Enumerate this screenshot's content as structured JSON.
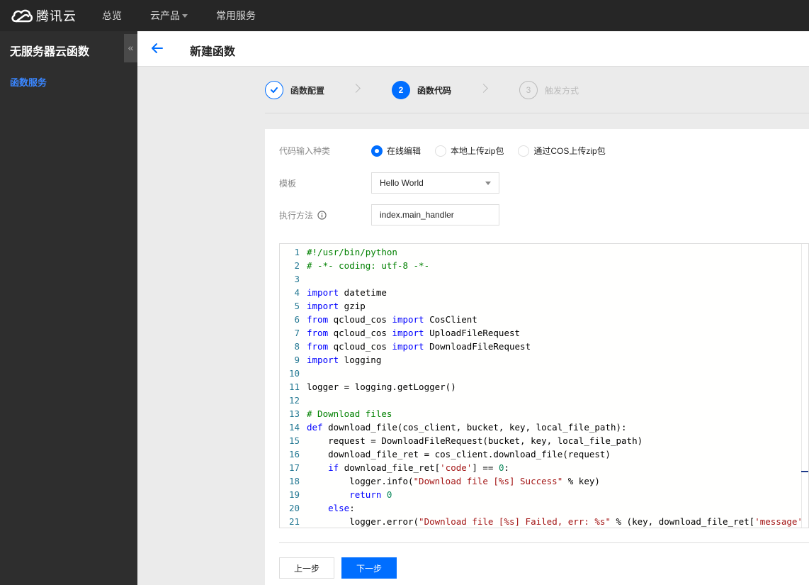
{
  "topbar": {
    "logo_text": "腾讯云",
    "nav": [
      {
        "label": "总览",
        "dropdown": false
      },
      {
        "label": "云产品",
        "dropdown": true
      },
      {
        "label": "常用服务",
        "dropdown": false
      }
    ]
  },
  "sidebar": {
    "title": "无服务器云函数",
    "collapse_icon": "«",
    "items": [
      {
        "label": "函数服务",
        "active": true
      }
    ]
  },
  "header": {
    "title": "新建函数",
    "back_icon": "arrow-left-icon"
  },
  "steps": [
    {
      "number": "1",
      "label": "函数配置",
      "status": "done"
    },
    {
      "number": "2",
      "label": "函数代码",
      "status": "current"
    },
    {
      "number": "3",
      "label": "触发方式",
      "status": "pending"
    }
  ],
  "form": {
    "code_input_type": {
      "label": "代码输入种类",
      "options": [
        {
          "label": "在线编辑",
          "checked": true
        },
        {
          "label": "本地上传zip包",
          "checked": false
        },
        {
          "label": "通过COS上传zip包",
          "checked": false
        }
      ]
    },
    "template": {
      "label": "模板",
      "value": "Hello World"
    },
    "handler": {
      "label": "执行方法",
      "value": "index.main_handler"
    }
  },
  "editor": {
    "lines": [
      {
        "n": "1",
        "tokens": [
          [
            "cm",
            "#!/usr/bin/python"
          ]
        ]
      },
      {
        "n": "2",
        "tokens": [
          [
            "cm",
            "# -*- coding: utf-8 -*-"
          ]
        ]
      },
      {
        "n": "3",
        "tokens": []
      },
      {
        "n": "4",
        "tokens": [
          [
            "kw",
            "import"
          ],
          [
            "code",
            " datetime"
          ]
        ]
      },
      {
        "n": "5",
        "tokens": [
          [
            "kw",
            "import"
          ],
          [
            "code",
            " gzip"
          ]
        ]
      },
      {
        "n": "6",
        "tokens": [
          [
            "kw",
            "from"
          ],
          [
            "code",
            " qcloud_cos "
          ],
          [
            "kw",
            "import"
          ],
          [
            "code",
            " CosClient"
          ]
        ]
      },
      {
        "n": "7",
        "tokens": [
          [
            "kw",
            "from"
          ],
          [
            "code",
            " qcloud_cos "
          ],
          [
            "kw",
            "import"
          ],
          [
            "code",
            " UploadFileRequest"
          ]
        ]
      },
      {
        "n": "8",
        "tokens": [
          [
            "kw",
            "from"
          ],
          [
            "code",
            " qcloud_cos "
          ],
          [
            "kw",
            "import"
          ],
          [
            "code",
            " DownloadFileRequest"
          ]
        ]
      },
      {
        "n": "9",
        "tokens": [
          [
            "kw",
            "import"
          ],
          [
            "code",
            " logging"
          ]
        ]
      },
      {
        "n": "10",
        "tokens": []
      },
      {
        "n": "11",
        "tokens": [
          [
            "code",
            "logger = logging.getLogger()"
          ]
        ]
      },
      {
        "n": "12",
        "tokens": []
      },
      {
        "n": "13",
        "tokens": [
          [
            "cm",
            "# Download files"
          ]
        ]
      },
      {
        "n": "14",
        "tokens": [
          [
            "kw",
            "def"
          ],
          [
            "code",
            " download_file(cos_client, bucket, key, local_file_path):"
          ]
        ]
      },
      {
        "n": "15",
        "tokens": [
          [
            "code",
            "    request = DownloadFileRequest(bucket, key, local_file_path)"
          ]
        ]
      },
      {
        "n": "16",
        "tokens": [
          [
            "code",
            "    download_file_ret = cos_client.download_file(request)"
          ]
        ]
      },
      {
        "n": "17",
        "tokens": [
          [
            "code",
            "    "
          ],
          [
            "kw",
            "if"
          ],
          [
            "code",
            " download_file_ret["
          ],
          [
            "str",
            "'code'"
          ],
          [
            "code",
            "] == "
          ],
          [
            "num",
            "0"
          ],
          [
            "code",
            ":"
          ]
        ]
      },
      {
        "n": "18",
        "tokens": [
          [
            "code",
            "        logger.info("
          ],
          [
            "str",
            "\"Download file [%s] Success\""
          ],
          [
            "code",
            " % key)"
          ]
        ]
      },
      {
        "n": "19",
        "tokens": [
          [
            "code",
            "        "
          ],
          [
            "kw",
            "return"
          ],
          [
            "code",
            " "
          ],
          [
            "num",
            "0"
          ]
        ]
      },
      {
        "n": "20",
        "tokens": [
          [
            "code",
            "    "
          ],
          [
            "kw",
            "else"
          ],
          [
            "code",
            ":"
          ]
        ]
      },
      {
        "n": "21",
        "tokens": [
          [
            "code",
            "        logger.error("
          ],
          [
            "str",
            "\"Download file [%s] Failed, err: %s\""
          ],
          [
            "code",
            " % (key, download_file_ret["
          ],
          [
            "str",
            "'message'"
          ],
          [
            "code",
            "]))"
          ]
        ]
      }
    ]
  },
  "buttons": {
    "prev": "上一步",
    "next": "下一步"
  },
  "colors": {
    "accent": "#006eff",
    "topbar": "#262626",
    "sidebar": "#2e2e2e",
    "sidebar_active": "#3a86ff"
  }
}
